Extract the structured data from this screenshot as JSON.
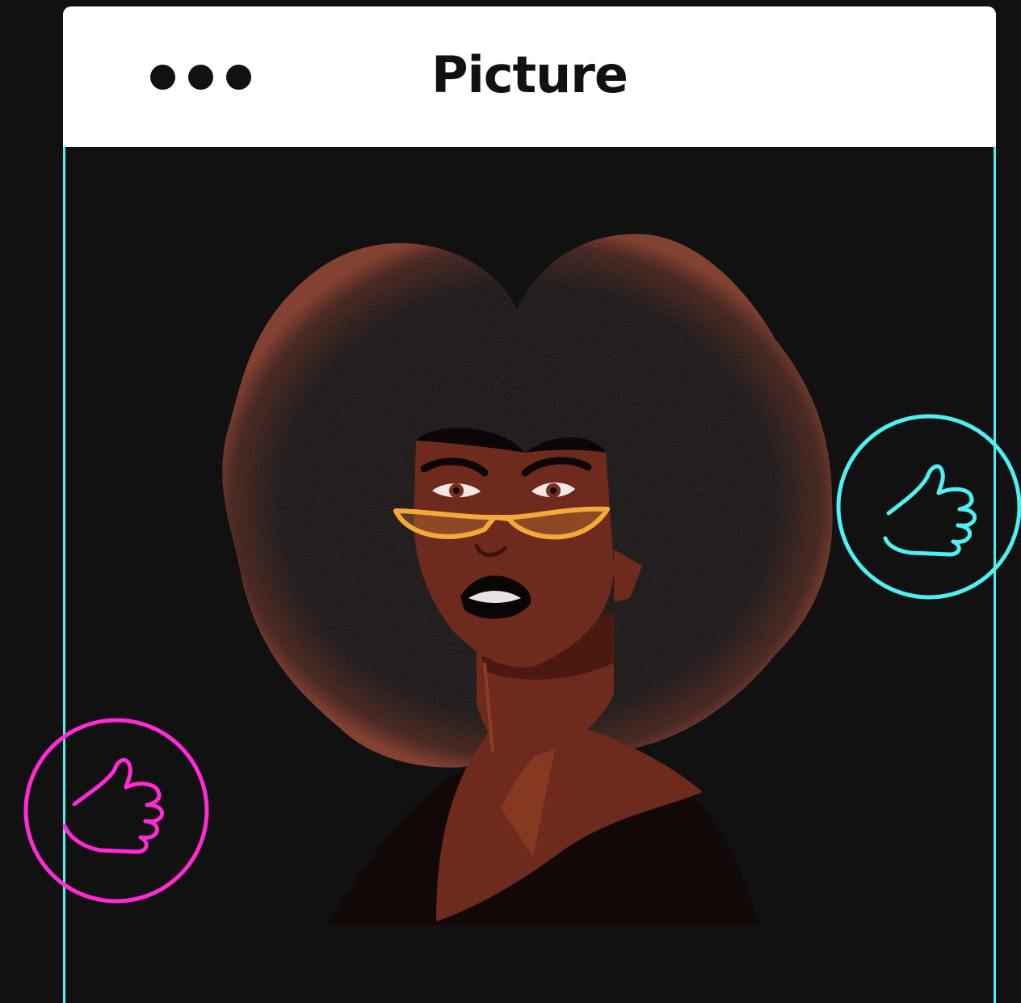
{
  "window": {
    "title": "Picture",
    "controls": [
      "dot",
      "dot",
      "dot"
    ]
  },
  "reactions": [
    {
      "icon": "thumbs-up-icon",
      "color": "#4ef0f2"
    },
    {
      "icon": "thumbs-up-icon",
      "color": "#ff2ad4"
    }
  ],
  "illustration": {
    "subject": "portrait",
    "colors": {
      "hair": "#0c0606",
      "hair_texture": "#7a2e1c",
      "skin": "#6d2a1d",
      "skin_shadow": "#4a1a12",
      "glasses": "#f5a93a",
      "lips": "#0a0606",
      "background": "#111111"
    }
  }
}
